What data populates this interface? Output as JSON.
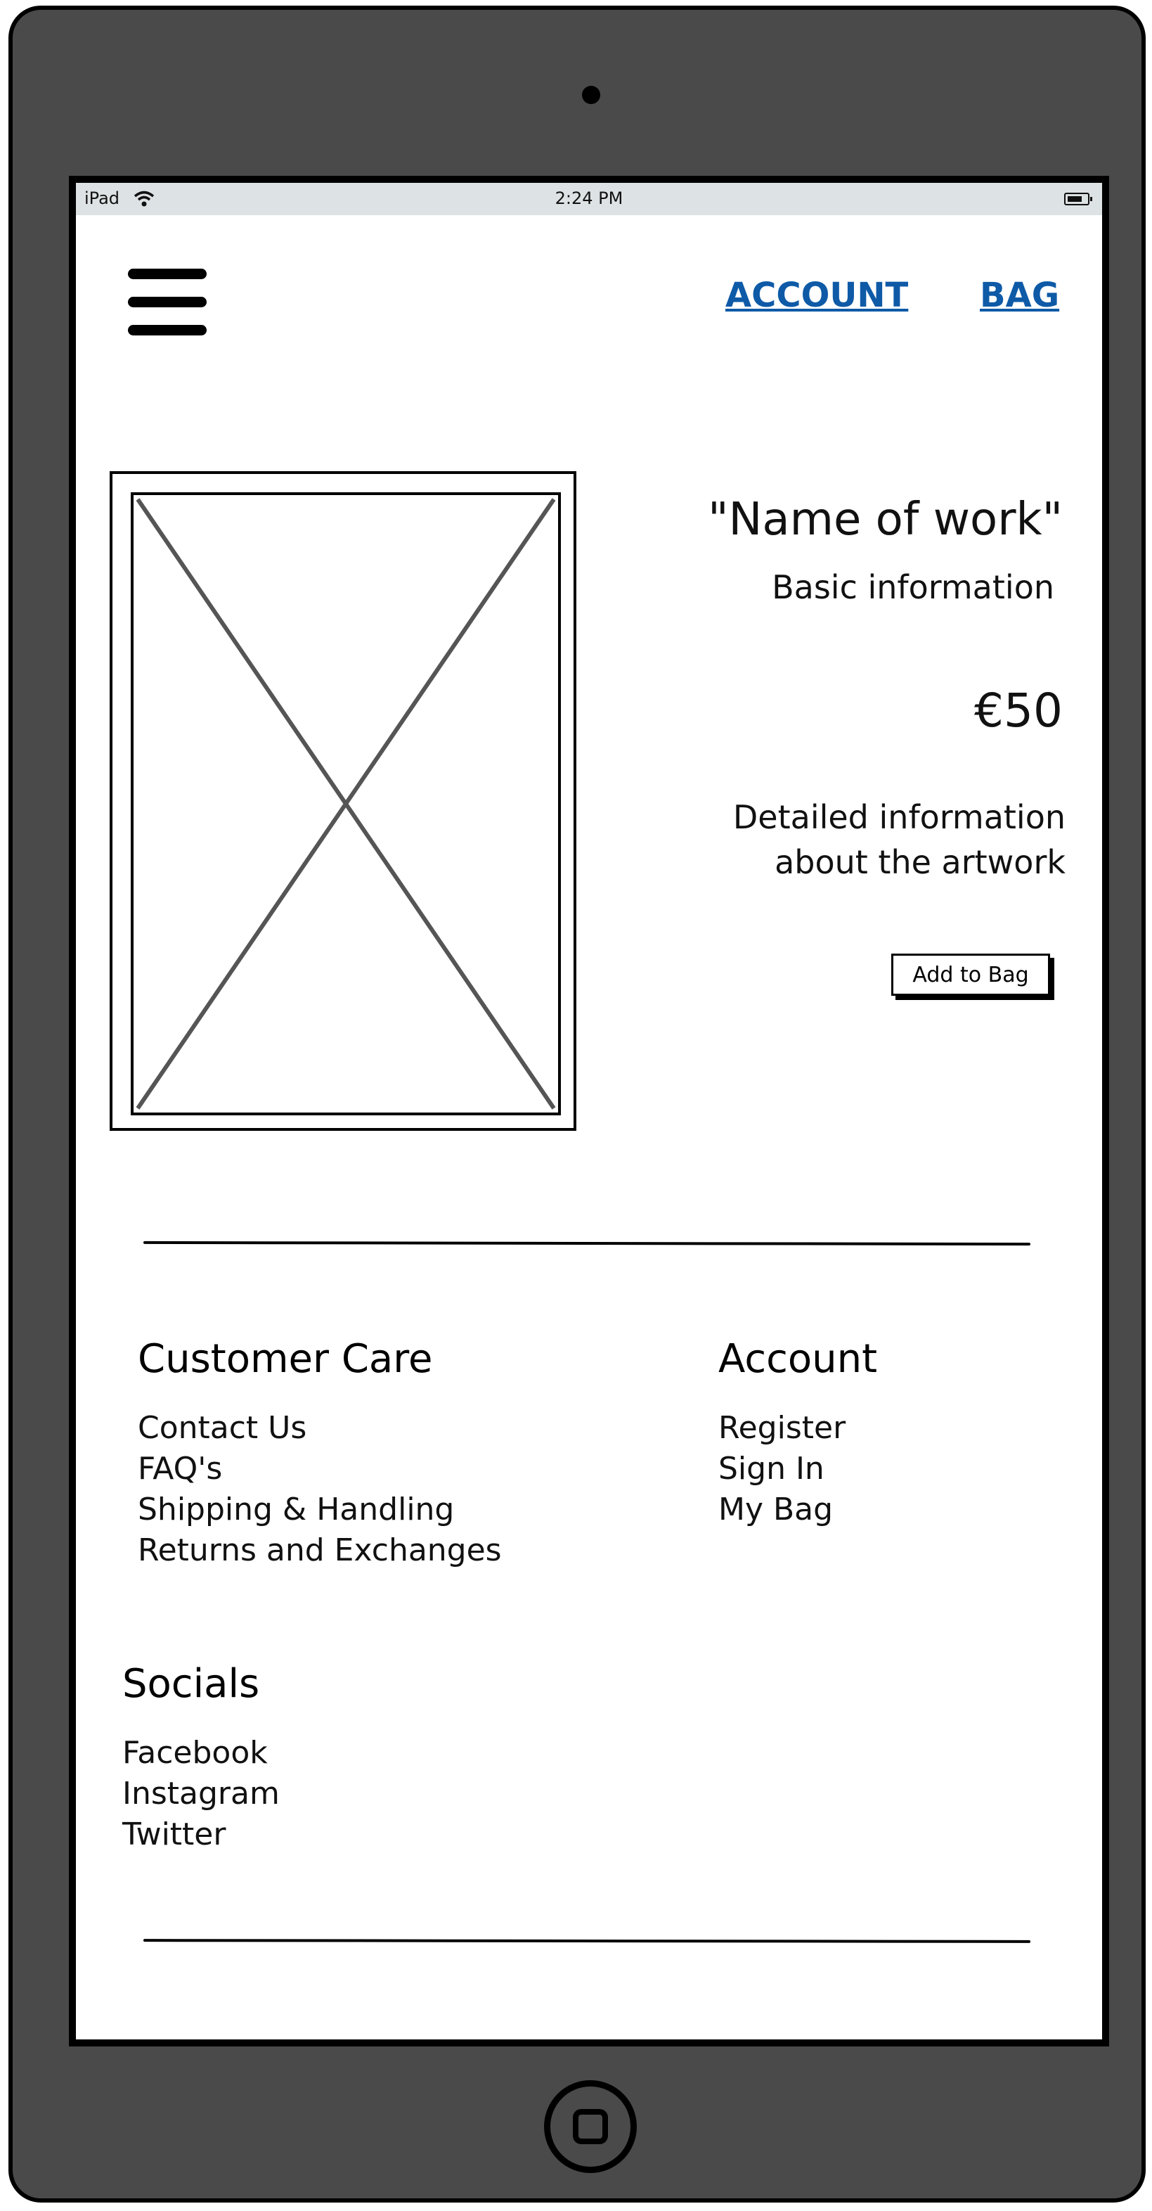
{
  "status_bar": {
    "carrier": "iPad",
    "time": "2:24 PM"
  },
  "header": {
    "nav": [
      {
        "label": "ACCOUNT"
      },
      {
        "label": "BAG"
      }
    ],
    "link_color": "#0e5aa7"
  },
  "product": {
    "title": "\"Name of work\"",
    "basic_info": "Basic information",
    "price": "€50",
    "detail_line1": "Detailed information",
    "detail_line2": "about the artwork",
    "add_button": "Add to Bag"
  },
  "footer": {
    "customer_care": {
      "heading": "Customer Care",
      "items": [
        "Contact Us",
        "FAQ's",
        "Shipping & Handling",
        "Returns and Exchanges"
      ]
    },
    "account": {
      "heading": "Account",
      "items": [
        "Register",
        "Sign In",
        "My Bag"
      ]
    },
    "socials": {
      "heading": "Socials",
      "items": [
        "Facebook",
        "Instagram",
        "Twitter"
      ]
    }
  },
  "icons": {
    "menu": "hamburger-menu-icon",
    "wifi": "wifi-icon",
    "battery": "battery-icon",
    "image_placeholder": "image-placeholder-icon",
    "home": "home-button-icon"
  }
}
